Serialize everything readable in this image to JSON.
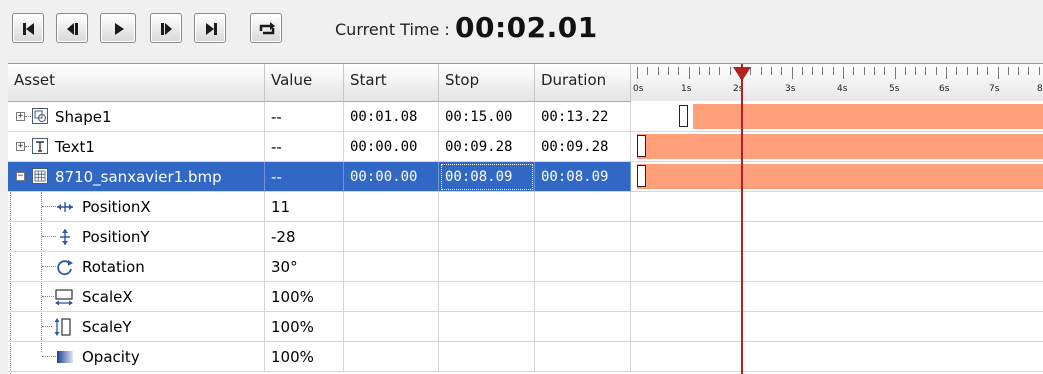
{
  "toolbar": {
    "buttons": [
      {
        "name": "go-to-start-button",
        "icon": "skip-to-start-icon"
      },
      {
        "name": "step-back-button",
        "icon": "step-back-icon"
      },
      {
        "name": "play-button",
        "icon": "play-icon"
      },
      {
        "name": "step-forward-button",
        "icon": "step-forward-icon"
      },
      {
        "name": "go-to-end-button",
        "icon": "skip-to-end-icon"
      },
      {
        "name": "loop-button",
        "icon": "loop-icon"
      }
    ],
    "current_time_label": "Current Time :",
    "current_time_value": "00:02.01"
  },
  "columns": {
    "asset": "Asset",
    "value": "Value",
    "start": "Start",
    "stop": "Stop",
    "duration": "Duration"
  },
  "timeline": {
    "ruler_labels": [
      "0s",
      "1s",
      "2s",
      "3s",
      "4s",
      "5s",
      "6s",
      "7s",
      "8"
    ],
    "current_time_seconds": 2.01,
    "bar_color": "#ffa07a",
    "selection_color": "#3168c6"
  },
  "rows": [
    {
      "asset": "Shape1",
      "icon": "shape-icon",
      "value": "--",
      "start": "00:01.08",
      "stop": "00:15.00",
      "duration": "00:13.22",
      "bar_start_s": 1.08,
      "bar_stop_s": 15.0
    },
    {
      "asset": "Text1",
      "icon": "text-icon",
      "value": "--",
      "start": "00:00.00",
      "stop": "00:09.28",
      "duration": "00:09.28",
      "bar_start_s": 0,
      "bar_stop_s": 9.28
    },
    {
      "asset": "8710_sanxavier1.bmp",
      "icon": "image-icon",
      "value": "--",
      "start": "00:00.00",
      "stop": "00:08.09",
      "duration": "00:08.09",
      "bar_start_s": 0,
      "bar_stop_s": 8.09,
      "selected": true
    }
  ],
  "properties": [
    {
      "label": "PositionX",
      "icon": "move-horizontal-icon",
      "value": "11"
    },
    {
      "label": "PositionY",
      "icon": "move-vertical-icon",
      "value": "-28"
    },
    {
      "label": "Rotation",
      "icon": "rotation-icon",
      "value": "30°"
    },
    {
      "label": "ScaleX",
      "icon": "scale-x-icon",
      "value": "100%"
    },
    {
      "label": "ScaleY",
      "icon": "scale-y-icon",
      "value": "100%"
    },
    {
      "label": "Opacity",
      "icon": "opacity-icon",
      "value": "100%"
    }
  ]
}
